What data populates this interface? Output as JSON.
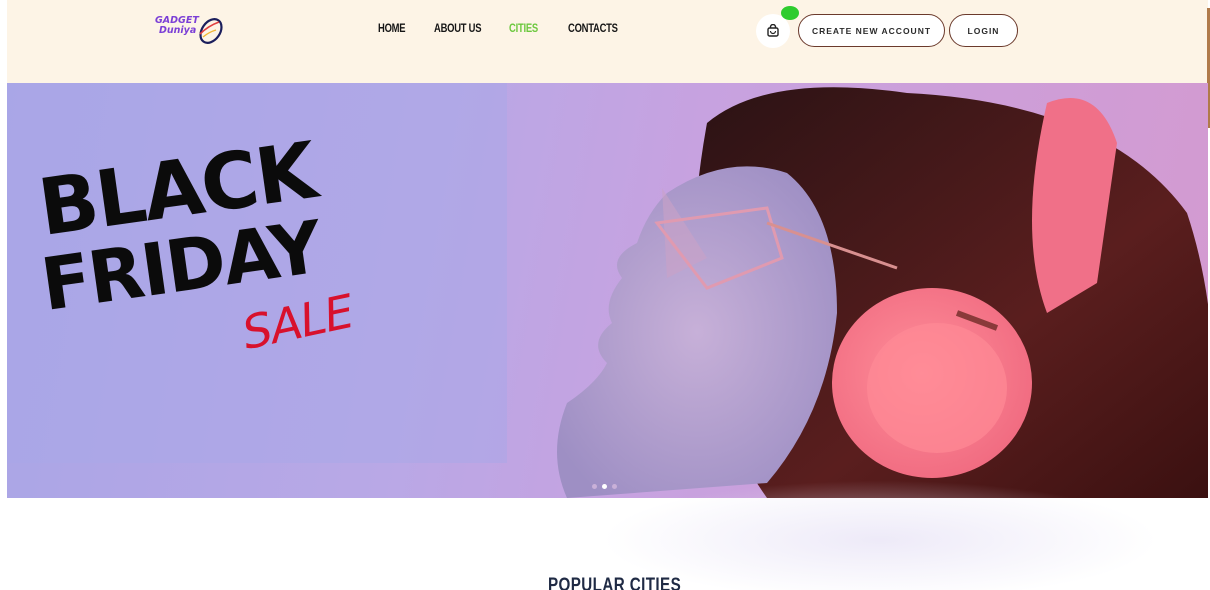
{
  "header": {
    "logo": {
      "line1": "GADGET",
      "line2": "Duniya"
    },
    "nav": [
      {
        "label": "HOME",
        "active": false
      },
      {
        "label": "ABOUT US",
        "active": false
      },
      {
        "label": "CITIES",
        "active": true
      },
      {
        "label": "CONTACTS",
        "active": false
      }
    ],
    "cart_icon": "shopping-bag-icon",
    "create_account_label": "CREATE NEW ACCOUNT",
    "login_label": "LOGIN"
  },
  "hero": {
    "line1": "BLACK",
    "line2": "FRIDAY",
    "line3": "SALE",
    "slide_count": 3,
    "active_slide": 2
  },
  "section": {
    "title": "POPULAR CITIES"
  },
  "colors": {
    "header_bg": "#fdf4e6",
    "nav_active": "#6cc83e",
    "button_border": "#6b3a2c",
    "cart_badge": "#2ecc2e",
    "sale_red": "#d8112c"
  }
}
